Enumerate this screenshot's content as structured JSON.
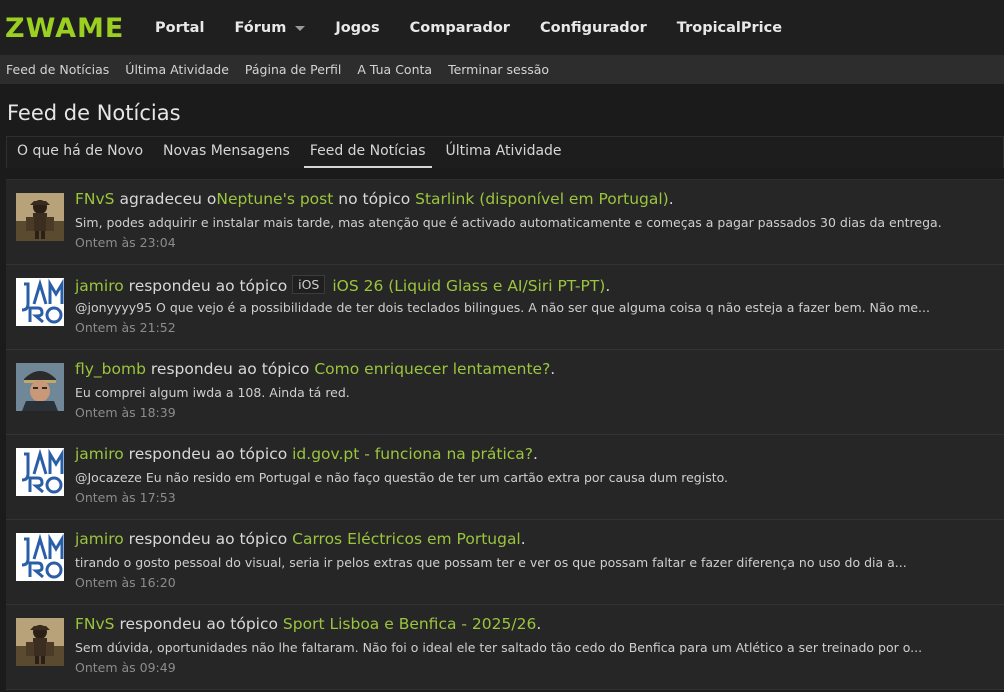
{
  "site": {
    "logo": "ZWAME"
  },
  "nav": {
    "tabs": [
      "Portal",
      "Fórum",
      "Jogos",
      "Comparador",
      "Configurador",
      "TropicalPrice"
    ]
  },
  "subnav": {
    "links": [
      "Feed de Notícias",
      "Última Atividade",
      "Página de Perfil",
      "A Tua Conta",
      "Terminar sessão"
    ]
  },
  "page": {
    "title": "Feed de Notícias"
  },
  "tabs": {
    "items": [
      "O que há de Novo",
      "Novas Mensagens",
      "Feed de Notícias",
      "Última Atividade"
    ],
    "active": "Feed de Notícias"
  },
  "feed": [
    {
      "user": "FNvS",
      "action": " agradeceu o",
      "target": "Neptune's post",
      "connector": " no tópico ",
      "prefix": "",
      "topic": "Starlink (disponível em Portugal)",
      "end": ".",
      "snippet": "Sim, podes adquirir e instalar mais tarde, mas atenção que é activado automaticamente e começas a pagar passados 30 dias da entrega.",
      "time": "Ontem às 23:04",
      "avatar": "samurai"
    },
    {
      "user": "jamiro",
      "action": " respondeu ao tópico ",
      "target": "",
      "connector": "",
      "prefix": "iOS",
      "topic": "iOS 26 (Liquid Glass e AI/Siri PT-PT)",
      "end": ".",
      "snippet": "@jonyyyy95 O que vejo é a possibilidade de ter dois teclados bilingues. A não ser que alguma coisa q não esteja a fazer bem. Não me...",
      "time": "Ontem às 21:52",
      "avatar": "jamiro"
    },
    {
      "user": "fly_bomb",
      "action": " respondeu ao tópico ",
      "target": "",
      "connector": "",
      "prefix": "",
      "topic": "Como enriquecer lentamente?",
      "end": ".",
      "snippet": "Eu comprei algum iwda a 108. Ainda tá red.",
      "time": "Ontem às 18:39",
      "avatar": "soldier"
    },
    {
      "user": "jamiro",
      "action": " respondeu ao tópico ",
      "target": "",
      "connector": "",
      "prefix": "",
      "topic": "id.gov.pt - funciona na prática?",
      "end": ".",
      "snippet": "@Jocazeze Eu não resido em Portugal e não faço questão de ter um cartão extra por causa dum registo.",
      "time": "Ontem às 17:53",
      "avatar": "jamiro"
    },
    {
      "user": "jamiro",
      "action": " respondeu ao tópico ",
      "target": "",
      "connector": "",
      "prefix": "",
      "topic": "Carros Eléctricos em Portugal",
      "end": ".",
      "snippet": "tirando o gosto pessoal do visual, seria ir pelos extras que possam ter e ver os que possam faltar e fazer diferença no uso do dia a...",
      "time": "Ontem às 16:20",
      "avatar": "jamiro"
    },
    {
      "user": "FNvS",
      "action": " respondeu ao tópico ",
      "target": "",
      "connector": "",
      "prefix": "",
      "topic": "Sport Lisboa e Benfica - 2025/26",
      "end": ".",
      "snippet": "Sem dúvida, oportunidades não lhe faltaram. Não foi o ideal ele ter saltado tão cedo do Benfica para um Atlético a ser treinado por o...",
      "time": "Ontem às 09:49",
      "avatar": "samurai"
    }
  ]
}
